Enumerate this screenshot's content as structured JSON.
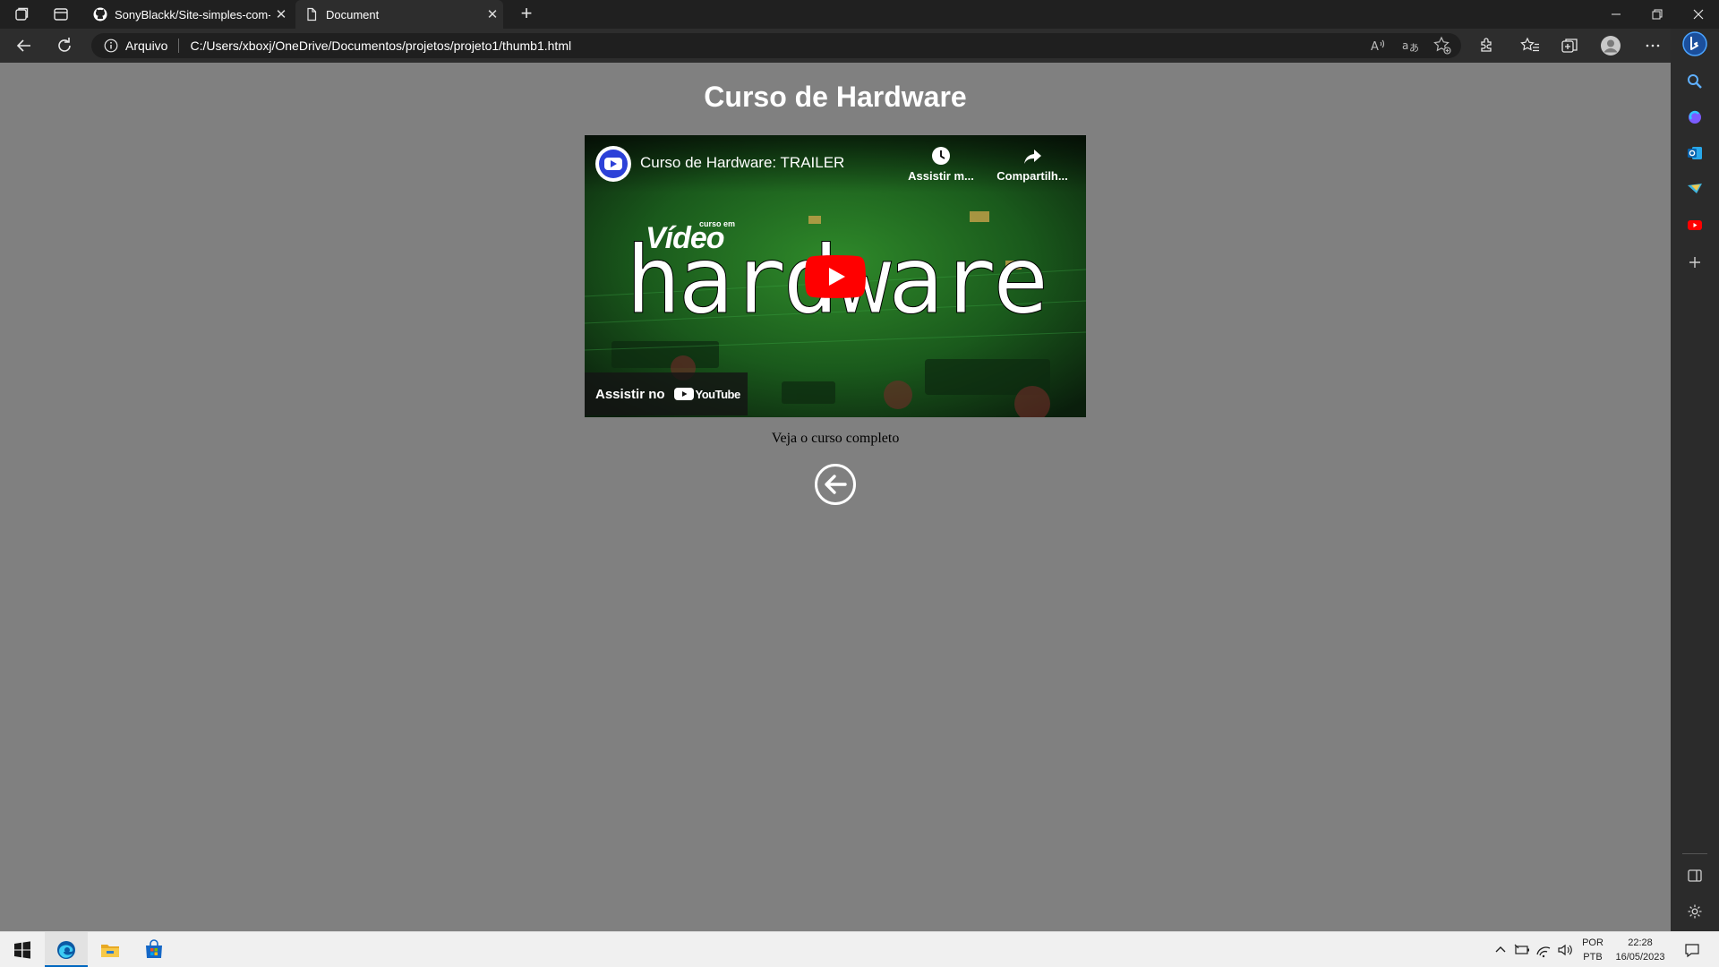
{
  "browser": {
    "tabs": [
      {
        "title": "SonyBlackk/Site-simples-com-vic",
        "active": false,
        "icon": "github-icon"
      },
      {
        "title": "Document",
        "active": true,
        "icon": "document-icon"
      }
    ],
    "address": {
      "scheme_label": "Arquivo",
      "url": "C:/Users/xboxj/OneDrive/Documentos/projetos/projeto1/thumb1.html"
    }
  },
  "page": {
    "title": "Curso de Hardware",
    "video": {
      "title": "Curso de Hardware: TRAILER",
      "watch_later_label": "Assistir m...",
      "share_label": "Compartilh...",
      "watch_on_label": "Assistir no",
      "youtube_label": "YouTube",
      "thumbnail_small_text": "curso em",
      "thumbnail_brand_text": "Vídeo",
      "thumbnail_main_text": "hardware"
    },
    "caption": "Veja o curso completo"
  },
  "taskbar": {
    "language": [
      "POR",
      "PTB"
    ],
    "time": "22:28",
    "date": "16/05/2023"
  },
  "colors": {
    "page_bg": "#808080",
    "youtube_red": "#ff0000",
    "edge_blue": "#0067c0"
  }
}
